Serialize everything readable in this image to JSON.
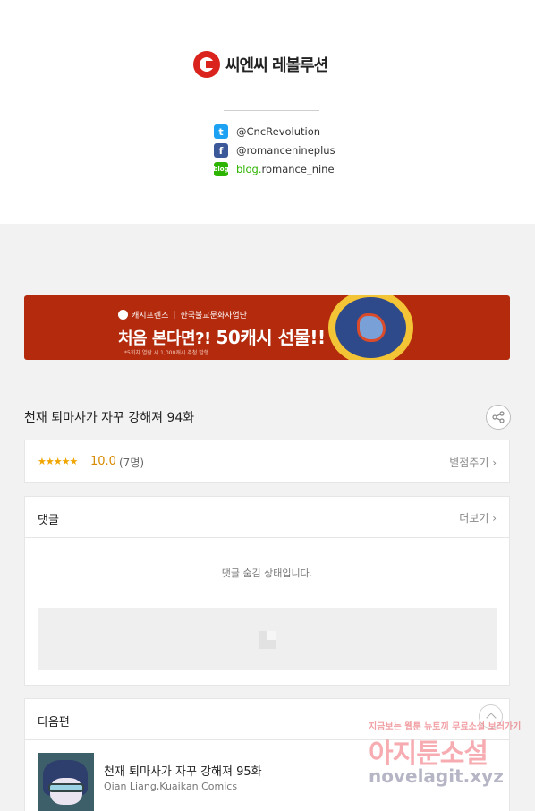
{
  "header": {
    "logo_text": "씨엔씨 레볼루션",
    "social": [
      {
        "icon": "twitter-icon",
        "text": "@CncRevolution"
      },
      {
        "icon": "facebook-icon",
        "text": "@romancenineplus"
      },
      {
        "icon": "blog-icon",
        "prefix": "blog.",
        "text": "romance_nine"
      }
    ]
  },
  "banner": {
    "brand": "캐시프렌즈",
    "partner": "한국불교문화사업단",
    "headline_prefix": "처음 본다면?!",
    "headline_bold": "50캐시 선물!!",
    "note": "*5회차 열람 시 1,000캐시 추첨 발행"
  },
  "episode": {
    "title": "천재 퇴마사가 자꾸 강해져 94화"
  },
  "rating": {
    "stars": "★★★★★",
    "score": "10.0",
    "count": "(7명)",
    "action": "별점주기 ›"
  },
  "comments": {
    "title": "댓글",
    "more": "더보기 ›",
    "hidden_text": "댓글 숨김 상태입니다."
  },
  "next": {
    "title": "다음편",
    "episode_title": "천재 퇴마사가 자꾸 강해져 95화",
    "author": "Qian Liang,Kuaikan Comics"
  },
  "watermark": {
    "line1": "지금보는 웹툰 뉴토끼 무료소설 보러가기",
    "line2": "아지툰소설",
    "line3": "novelagit.xyz"
  },
  "colors": {
    "brand_red": "#d9231c",
    "banner_bg": "#b32a0c",
    "rating_orange": "#d88a00",
    "star": "#f0a500"
  }
}
